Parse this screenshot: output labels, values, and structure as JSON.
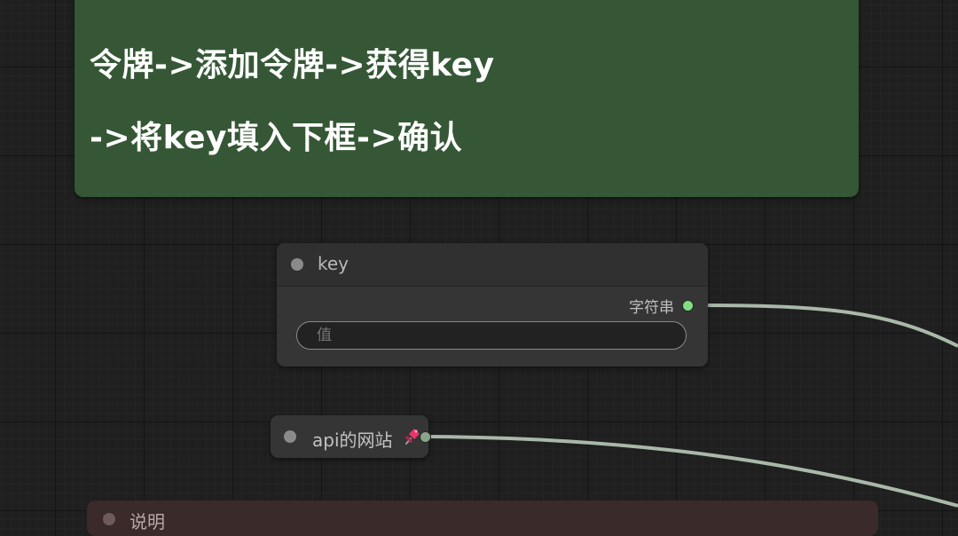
{
  "note": {
    "line1": "令牌->添加令牌->获得key",
    "line2": "->将key填入下框->确认",
    "color": "#355735"
  },
  "key_node": {
    "title": "key",
    "output_label": "字符串",
    "input_placeholder": "值",
    "socket_color": "#7fe07f"
  },
  "api_node": {
    "title": "api的网站",
    "pin_icon": "pushpin-icon"
  },
  "bottom_note": {
    "title": "说明"
  },
  "link_color": "#a9b8a9"
}
